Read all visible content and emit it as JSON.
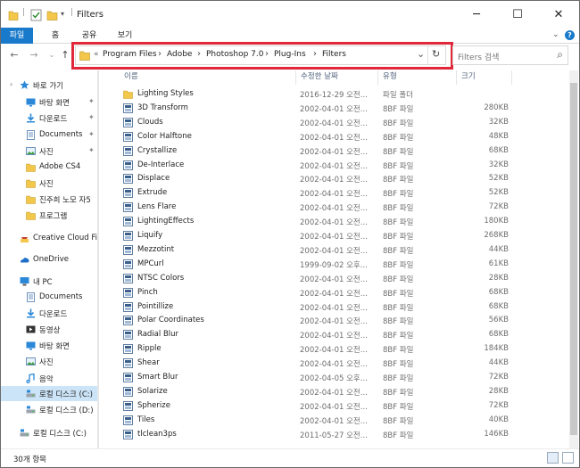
{
  "window": {
    "title": "Filters",
    "min_glyph": "─",
    "max_glyph": "☐",
    "close_glyph": "✕"
  },
  "ribbon": {
    "tabs": [
      {
        "label": "파일",
        "active": true
      },
      {
        "label": "홈",
        "active": false
      },
      {
        "label": "공유",
        "active": false
      },
      {
        "label": "보기",
        "active": false
      }
    ],
    "expand_glyph": "⌄",
    "help_glyph": "?"
  },
  "nav": {
    "back": "←",
    "forward": "→",
    "recent": "⌄",
    "up": "↑"
  },
  "address": {
    "prefix": "«",
    "crumbs": [
      "Program Files",
      "Adobe",
      "Photoshop 7.0",
      "Plug-Ins",
      "Filters"
    ],
    "dropdown_glyph": "⌄",
    "refresh_glyph": "↻"
  },
  "search": {
    "placeholder": "Filters 검색",
    "icon_glyph": "⌕"
  },
  "sidebar": {
    "items": [
      {
        "label": "바로 가기",
        "icon": "star-icon",
        "pin": false,
        "selected": false,
        "indent": 0,
        "caret": "›"
      },
      {
        "label": "바탕 화면",
        "icon": "desktop-icon",
        "pin": true,
        "selected": false,
        "indent": 1
      },
      {
        "label": "다운로드",
        "icon": "download-icon",
        "pin": true,
        "selected": false,
        "indent": 1
      },
      {
        "label": "Documents",
        "icon": "documents-icon",
        "pin": true,
        "selected": false,
        "indent": 1
      },
      {
        "label": "사진",
        "icon": "pictures-icon",
        "pin": true,
        "selected": false,
        "indent": 1
      },
      {
        "label": "Adobe CS4",
        "icon": "folder-icon",
        "pin": false,
        "selected": false,
        "indent": 1
      },
      {
        "label": "사진",
        "icon": "folder-icon",
        "pin": false,
        "selected": false,
        "indent": 1
      },
      {
        "label": "진주희 노모 자5",
        "icon": "folder-icon",
        "pin": false,
        "selected": false,
        "indent": 1
      },
      {
        "label": "프로그램",
        "icon": "folder-icon",
        "pin": false,
        "selected": false,
        "indent": 1
      },
      {
        "label": "Creative Cloud Fi",
        "icon": "creative-cloud-icon",
        "pin": false,
        "selected": false,
        "indent": 0
      },
      {
        "label": "OneDrive",
        "icon": "onedrive-icon",
        "pin": false,
        "selected": false,
        "indent": 0
      },
      {
        "label": "내 PC",
        "icon": "pc-icon",
        "pin": false,
        "selected": false,
        "indent": 0
      },
      {
        "label": "Documents",
        "icon": "documents-icon",
        "pin": false,
        "selected": false,
        "indent": 1
      },
      {
        "label": "다운로드",
        "icon": "download-icon",
        "pin": false,
        "selected": false,
        "indent": 1
      },
      {
        "label": "동영상",
        "icon": "video-icon",
        "pin": false,
        "selected": false,
        "indent": 1
      },
      {
        "label": "바탕 화면",
        "icon": "desktop-icon",
        "pin": false,
        "selected": false,
        "indent": 1
      },
      {
        "label": "사진",
        "icon": "pictures-icon",
        "pin": false,
        "selected": false,
        "indent": 1
      },
      {
        "label": "음악",
        "icon": "music-icon",
        "pin": false,
        "selected": false,
        "indent": 1
      },
      {
        "label": "로컬 디스크 (C:)",
        "icon": "drive-icon",
        "pin": false,
        "selected": true,
        "indent": 1
      },
      {
        "label": "로컬 디스크 (D:)",
        "icon": "drive-icon",
        "pin": false,
        "selected": false,
        "indent": 1
      },
      {
        "label": "로컬 디스크 (C:)",
        "icon": "drive-icon",
        "pin": false,
        "selected": false,
        "indent": 0
      }
    ]
  },
  "columns": {
    "name": "이름",
    "date": "수정한 날짜",
    "type": "유형",
    "size": "크기"
  },
  "files": [
    {
      "name": "Lighting Styles",
      "date": "2016-12-29 오전...",
      "type": "파일 폴더",
      "size": "",
      "icon": "folder-icon"
    },
    {
      "name": "3D Transform",
      "date": "2002-04-01 오전...",
      "type": "8BF 파일",
      "size": "280KB",
      "icon": "plugin-icon"
    },
    {
      "name": "Clouds",
      "date": "2002-04-01 오전...",
      "type": "8BF 파일",
      "size": "32KB",
      "icon": "plugin-icon"
    },
    {
      "name": "Color Halftone",
      "date": "2002-04-01 오전...",
      "type": "8BF 파일",
      "size": "48KB",
      "icon": "plugin-icon"
    },
    {
      "name": "Crystallize",
      "date": "2002-04-01 오전...",
      "type": "8BF 파일",
      "size": "68KB",
      "icon": "plugin-icon"
    },
    {
      "name": "De-Interlace",
      "date": "2002-04-01 오전...",
      "type": "8BF 파일",
      "size": "32KB",
      "icon": "plugin-icon"
    },
    {
      "name": "Displace",
      "date": "2002-04-01 오전...",
      "type": "8BF 파일",
      "size": "52KB",
      "icon": "plugin-icon"
    },
    {
      "name": "Extrude",
      "date": "2002-04-01 오전...",
      "type": "8BF 파일",
      "size": "52KB",
      "icon": "plugin-icon"
    },
    {
      "name": "Lens Flare",
      "date": "2002-04-01 오전...",
      "type": "8BF 파일",
      "size": "72KB",
      "icon": "plugin-icon"
    },
    {
      "name": "LightingEffects",
      "date": "2002-04-01 오전...",
      "type": "8BF 파일",
      "size": "180KB",
      "icon": "plugin-icon"
    },
    {
      "name": "Liquify",
      "date": "2002-04-01 오전...",
      "type": "8BF 파일",
      "size": "268KB",
      "icon": "plugin-icon"
    },
    {
      "name": "Mezzotint",
      "date": "2002-04-01 오전...",
      "type": "8BF 파일",
      "size": "44KB",
      "icon": "plugin-icon"
    },
    {
      "name": "MPCurl",
      "date": "1999-09-02 오후...",
      "type": "8BF 파일",
      "size": "61KB",
      "icon": "plugin-icon"
    },
    {
      "name": "NTSC Colors",
      "date": "2002-04-01 오전...",
      "type": "8BF 파일",
      "size": "28KB",
      "icon": "plugin-icon"
    },
    {
      "name": "Pinch",
      "date": "2002-04-01 오전...",
      "type": "8BF 파일",
      "size": "68KB",
      "icon": "plugin-icon"
    },
    {
      "name": "Pointillize",
      "date": "2002-04-01 오전...",
      "type": "8BF 파일",
      "size": "68KB",
      "icon": "plugin-icon"
    },
    {
      "name": "Polar Coordinates",
      "date": "2002-04-01 오전...",
      "type": "8BF 파일",
      "size": "56KB",
      "icon": "plugin-icon"
    },
    {
      "name": "Radial Blur",
      "date": "2002-04-01 오전...",
      "type": "8BF 파일",
      "size": "68KB",
      "icon": "plugin-icon"
    },
    {
      "name": "Ripple",
      "date": "2002-04-01 오전...",
      "type": "8BF 파일",
      "size": "184KB",
      "icon": "plugin-icon"
    },
    {
      "name": "Shear",
      "date": "2002-04-01 오전...",
      "type": "8BF 파일",
      "size": "44KB",
      "icon": "plugin-icon"
    },
    {
      "name": "Smart Blur",
      "date": "2002-04-05 오후...",
      "type": "8BF 파일",
      "size": "72KB",
      "icon": "plugin-icon"
    },
    {
      "name": "Solarize",
      "date": "2002-04-01 오전...",
      "type": "8BF 파일",
      "size": "28KB",
      "icon": "plugin-icon"
    },
    {
      "name": "Spherize",
      "date": "2002-04-01 오전...",
      "type": "8BF 파일",
      "size": "72KB",
      "icon": "plugin-icon"
    },
    {
      "name": "Tiles",
      "date": "2002-04-01 오전...",
      "type": "8BF 파일",
      "size": "40KB",
      "icon": "plugin-icon"
    },
    {
      "name": "tlclean3ps",
      "date": "2011-05-27 오전...",
      "type": "8BF 파일",
      "size": "146KB",
      "icon": "plugin-icon"
    }
  ],
  "status": {
    "item_count": "30개 항목"
  },
  "colors": {
    "accent": "#1979ca",
    "highlight_box": "#e0283a",
    "selected_bg": "#cce4f7",
    "folder_yellow": "#f3c74a"
  }
}
